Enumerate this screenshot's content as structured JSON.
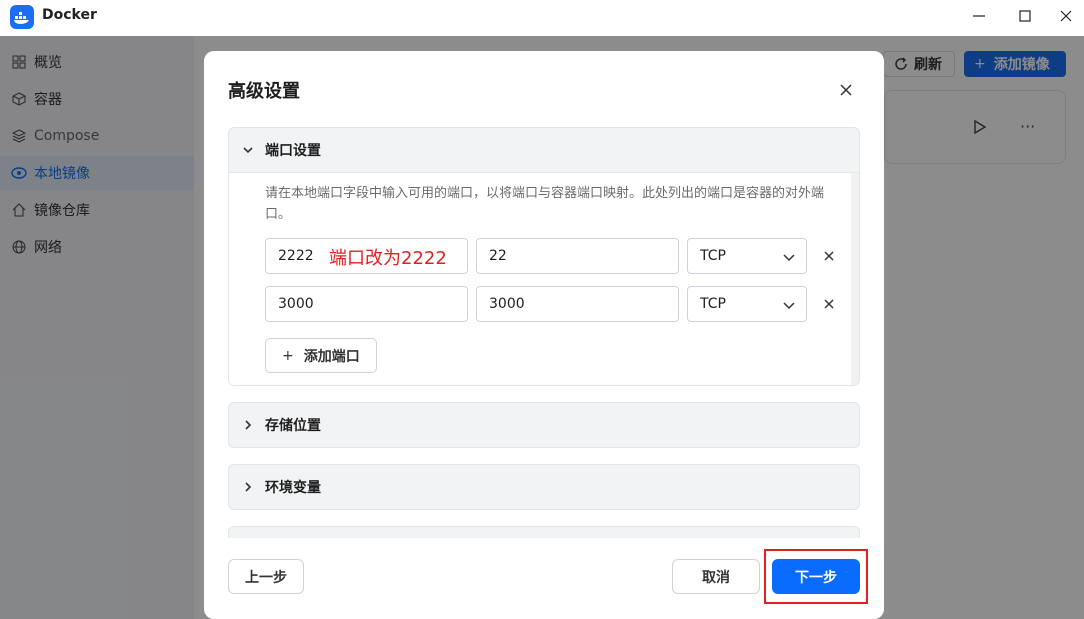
{
  "window": {
    "title": "Docker"
  },
  "sidebar": {
    "items": [
      {
        "label": "概览",
        "icon": "grid-icon"
      },
      {
        "label": "容器",
        "icon": "cube-icon"
      },
      {
        "label": "Compose",
        "icon": "layers-icon"
      },
      {
        "label": "本地镜像",
        "icon": "eye-icon",
        "active": true
      },
      {
        "label": "镜像仓库",
        "icon": "home-icon"
      },
      {
        "label": "网络",
        "icon": "globe-icon"
      }
    ]
  },
  "toolbar": {
    "refresh_label": "刷新",
    "add_image_label": "添加镜像"
  },
  "modal": {
    "title": "高级设置",
    "sections": {
      "ports": {
        "title": "端口设置",
        "description": "请在本地端口字段中输入可用的端口，以将端口与容器端口映射。此处列出的端口是容器的对外端口。",
        "rows": [
          {
            "local": "2222",
            "container": "22",
            "protocol": "TCP"
          },
          {
            "local": "3000",
            "container": "3000",
            "protocol": "TCP"
          }
        ],
        "add_label": "添加端口"
      },
      "storage": {
        "title": "存储位置"
      },
      "env": {
        "title": "环境变量"
      }
    },
    "annotation": "端口改为2222",
    "buttons": {
      "prev": "上一步",
      "cancel": "取消",
      "next": "下一步"
    }
  },
  "colors": {
    "accent": "#0a6cff",
    "annotation": "#e02020"
  }
}
